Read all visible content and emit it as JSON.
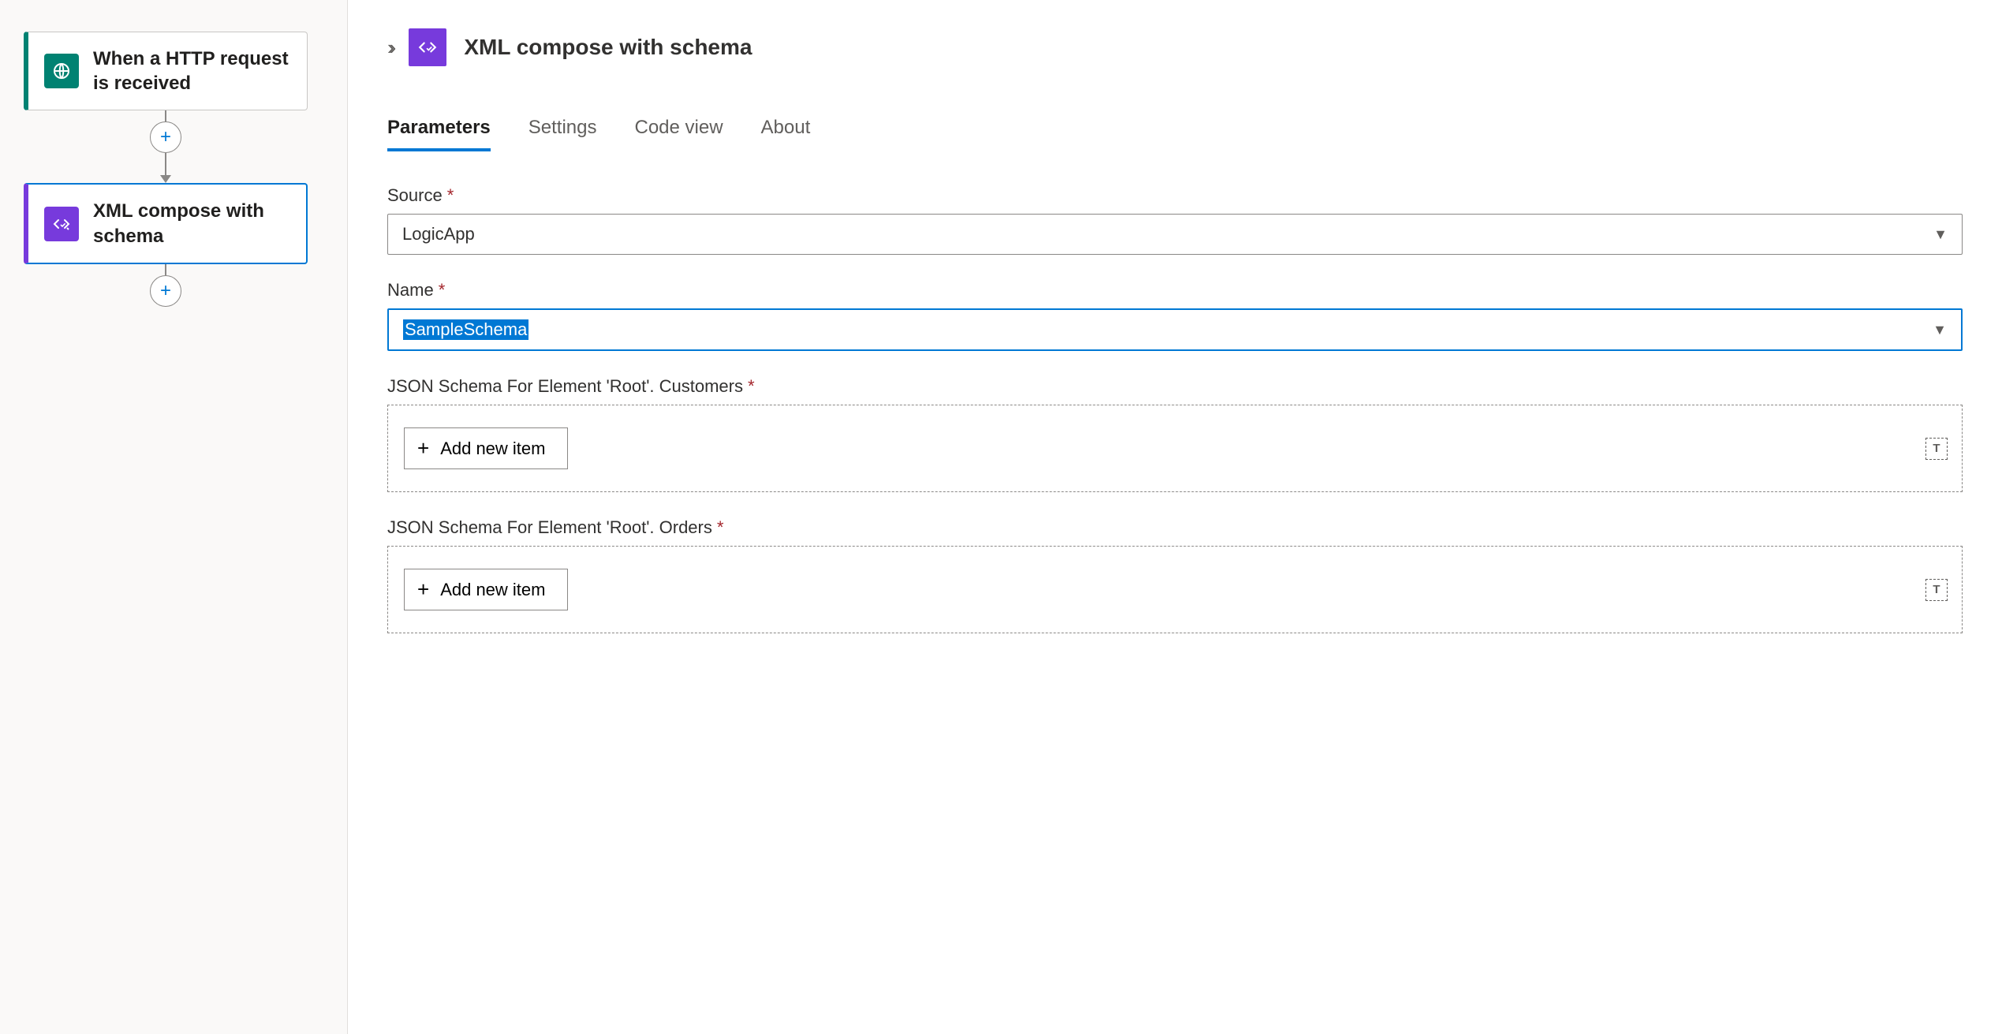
{
  "canvas": {
    "trigger": {
      "title": "When a HTTP request is received"
    },
    "action": {
      "title": "XML compose with schema"
    }
  },
  "panel": {
    "title": "XML compose with schema",
    "tabs": {
      "parameters": "Parameters",
      "settings": "Settings",
      "code_view": "Code view",
      "about": "About"
    },
    "fields": {
      "source": {
        "label": "Source",
        "value": "LogicApp"
      },
      "name": {
        "label": "Name",
        "value": "SampleSchema"
      },
      "customers": {
        "label": "JSON Schema For Element 'Root'. Customers",
        "button": "Add new item"
      },
      "orders": {
        "label": "JSON Schema For Element 'Root'. Orders",
        "button": "Add new item"
      }
    }
  }
}
